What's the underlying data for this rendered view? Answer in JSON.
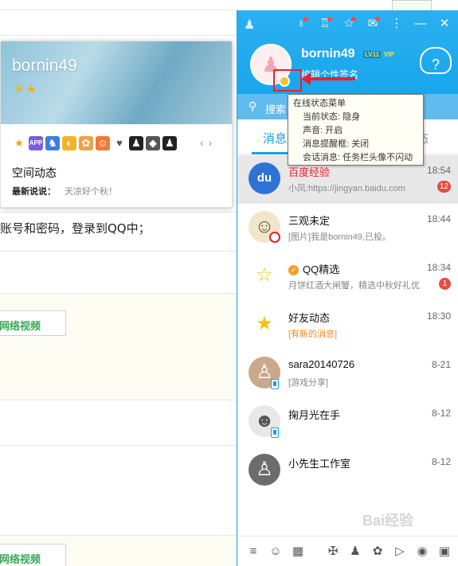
{
  "background_page": {
    "instruction_text": "账号和密码，登录到QQ中；",
    "video_button_1": "网络视频",
    "video_button_2": "网络视频"
  },
  "profile_card": {
    "username": "bornin49",
    "level_icons": [
      "sun-icon",
      "star-icon"
    ],
    "badges": [
      "star-icon",
      "app-icon",
      "game-icon",
      "coin-icon",
      "pet-icon",
      "face-icon",
      "heart-icon",
      "penguin-icon",
      "diamond-icon",
      "penguin-icon"
    ],
    "section_title": "空间动态",
    "mood_label": "最新说说：",
    "mood_text": "天凉好个秋！"
  },
  "qq": {
    "username": "bornin49",
    "level_badge": "LV11",
    "vip_badge": "VIP",
    "signature_placeholder": "编辑个性签名",
    "search_label": "搜索",
    "tabs": {
      "messages": "消息",
      "other": "态"
    },
    "tooltip": {
      "title": "在线状态菜单",
      "rows": [
        "当前状态: 隐身",
        "声音: 开启",
        "消息提醒框: 关闭",
        "会话消息: 任务栏头像不闪动"
      ]
    },
    "conversations": [
      {
        "title": "百度经验",
        "time": "18:54",
        "preview": "小凤:https://jingyan.baidu.com",
        "badge": "12",
        "avatar_color": "#2f72d6",
        "avatar_icon": "paw-icon",
        "selected": true,
        "title_color": "#e8212e"
      },
      {
        "title": "三观未定",
        "time": "18:44",
        "preview": "[图片]我是bornin49,已投。",
        "badge": "",
        "avatar_color": "#f2e6c9",
        "avatar_icon": "cartoon-face-icon",
        "selected": false,
        "title_color": "#111"
      },
      {
        "title": "QQ精选",
        "time": "18:34",
        "preview": "月饼红酒大闸蟹，精选中秋好礼优",
        "badge": "1",
        "avatar_color": "#ffffff",
        "avatar_icon": "star-outline-icon",
        "selected": false,
        "title_color": "#111"
      },
      {
        "title": "好友动态",
        "time": "18:30",
        "preview": "[有新的消息]",
        "badge": "",
        "avatar_color": "#ffffff",
        "avatar_icon": "star-z-icon",
        "selected": false,
        "title_color": "#111"
      },
      {
        "title": "sara20140726",
        "time": "8-21",
        "preview": "[游戏分享]",
        "badge": "",
        "avatar_color": "#c9a98a",
        "avatar_icon": "person-icon",
        "selected": false,
        "title_color": "#111"
      },
      {
        "title": "掬月光在手",
        "time": "8-12",
        "preview": "",
        "badge": "",
        "avatar_color": "#e8e8e8",
        "avatar_icon": "person-glasses-icon",
        "selected": false,
        "title_color": "#111"
      },
      {
        "title": "小先生工作室",
        "time": "8-12",
        "preview": "",
        "badge": "",
        "avatar_color": "#6c6c6c",
        "avatar_icon": "person-icon",
        "selected": false,
        "title_color": "#111"
      }
    ]
  }
}
